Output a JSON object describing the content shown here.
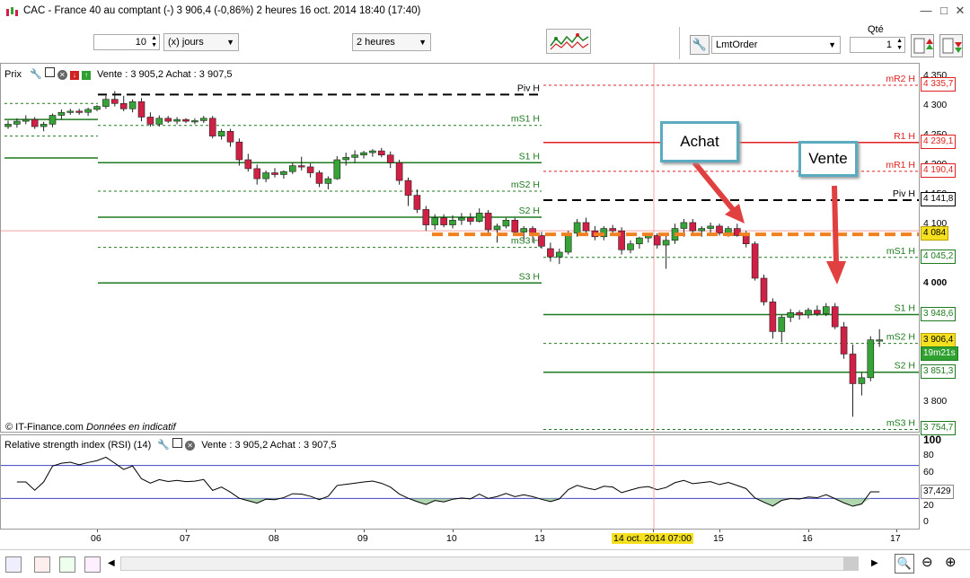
{
  "window": {
    "title": "CAC - France 40 au comptant (-)   3 906,4  (-0,86%)    2 heures   16 oct. 2014 18:40 (17:40)"
  },
  "toolbar": {
    "period_count": "10",
    "period_unit": "(x) jours",
    "interval": "2 heures",
    "qty_label": "Qté",
    "qty_value": "1",
    "order_type": "LmtOrder"
  },
  "price_panel": {
    "header_label": "Prix",
    "quote": "Vente : 3 905,2  Achat : 3 907,5",
    "copyright": "© IT-Finance.com",
    "disclaimer": "Données en indicatif"
  },
  "rsi_panel": {
    "header_label": "Relative strength index (RSI) (14)",
    "quote": "Vente : 3 905,2  Achat : 3 907,5",
    "last_value": "37,429"
  },
  "callouts": {
    "achat": "Achat",
    "vente": "Vente"
  },
  "pivots_left": [
    {
      "label": "Piv H",
      "price": 4320
    },
    {
      "label": "mS1 H",
      "price": 4268
    },
    {
      "label": "S1 H",
      "price": 4205
    },
    {
      "label": "mS2 H",
      "price": 4157
    },
    {
      "label": "S2 H",
      "price": 4113
    },
    {
      "label": "mS3 H",
      "price": 4062
    },
    {
      "label": "S3 H",
      "price": 4002
    }
  ],
  "pivots_right": [
    {
      "label": "mR2 H",
      "price_text": "4 335,7",
      "price": 4335.7
    },
    {
      "label": "R1 H",
      "price_text": "4 239,1",
      "price": 4239.1
    },
    {
      "label": "mR1 H",
      "price_text": "4 190,4",
      "price": 4190.4
    },
    {
      "label": "Piv H",
      "price_text": "4 141,8",
      "price": 4141.8
    },
    {
      "label": "mS1 H",
      "price_text": "4 045,2",
      "price": 4045.2
    },
    {
      "label": "S1 H",
      "price_text": "3 948,6",
      "price": 3948.6
    },
    {
      "label": "mS2 H",
      "price_text": "3 900,0",
      "price": 3900.0
    },
    {
      "label": "S2 H",
      "price_text": "3 851,3",
      "price": 3851.3
    },
    {
      "label": "mS3 H",
      "price_text": "3 754,7",
      "price": 3754.7
    }
  ],
  "price_axis": {
    "ticks": [
      "4 350",
      "4 300",
      "4 250",
      "4 200",
      "4 150",
      "4 100",
      "4 050",
      "4 000",
      "3 950",
      "3 900",
      "3 850",
      "3 800"
    ],
    "orange_level": {
      "text": "4 084",
      "price": 4084
    },
    "last_price": "3 906,4",
    "countdown": "19m21s"
  },
  "rsi_axis": {
    "ticks": [
      "100",
      "80",
      "60",
      "40",
      "20",
      "0"
    ],
    "levels": [
      70,
      30
    ]
  },
  "x_axis": {
    "labels": [
      "06",
      "07",
      "08",
      "09",
      "10",
      "13",
      "14 oct. 2014 07:00",
      "15",
      "16",
      "17"
    ]
  },
  "colors": {
    "bull": "#36a336",
    "bear": "#d02045",
    "support": "#1f7a1f",
    "resistance": "#e02020",
    "pivot": "#000000",
    "orange": "#f08020",
    "callout_border": "#5aaac0",
    "arrow": "#e04040",
    "rsi_line": "#000000",
    "rsi_fill": "#9ccc9c",
    "rsi_level": "#4040c0"
  },
  "icons": {
    "app": "candlestick-app-icon",
    "settings": "wrench-icon",
    "close": "close-icon"
  },
  "chart_data": {
    "type": "candlestick",
    "title": "CAC - France 40 au comptant (-)",
    "xlabel": "",
    "ylabel": "",
    "ylim": [
      3760,
      4360
    ],
    "candles": [
      [
        4266,
        4276,
        4262,
        4270
      ],
      [
        4270,
        4280,
        4264,
        4275
      ],
      [
        4275,
        4285,
        4270,
        4278
      ],
      [
        4278,
        4282,
        4262,
        4266
      ],
      [
        4266,
        4274,
        4258,
        4270
      ],
      [
        4270,
        4288,
        4265,
        4285
      ],
      [
        4285,
        4295,
        4278,
        4290
      ],
      [
        4290,
        4296,
        4286,
        4292
      ],
      [
        4292,
        4296,
        4286,
        4290
      ],
      [
        4290,
        4298,
        4284,
        4295
      ],
      [
        4295,
        4302,
        4292,
        4300
      ],
      [
        4300,
        4318,
        4296,
        4312
      ],
      [
        4312,
        4326,
        4300,
        4305
      ],
      [
        4305,
        4318,
        4292,
        4296
      ],
      [
        4296,
        4312,
        4290,
        4308
      ],
      [
        4308,
        4314,
        4275,
        4282
      ],
      [
        4282,
        4290,
        4266,
        4270
      ],
      [
        4270,
        4285,
        4266,
        4280
      ],
      [
        4280,
        4284,
        4272,
        4275
      ],
      [
        4275,
        4282,
        4270,
        4278
      ],
      [
        4278,
        4280,
        4272,
        4275
      ],
      [
        4275,
        4280,
        4270,
        4276
      ],
      [
        4276,
        4284,
        4272,
        4280
      ],
      [
        4280,
        4284,
        4246,
        4250
      ],
      [
        4250,
        4262,
        4244,
        4258
      ],
      [
        4258,
        4262,
        4232,
        4240
      ],
      [
        4240,
        4246,
        4200,
        4210
      ],
      [
        4210,
        4220,
        4190,
        4195
      ],
      [
        4195,
        4202,
        4168,
        4178
      ],
      [
        4178,
        4192,
        4172,
        4188
      ],
      [
        4188,
        4196,
        4180,
        4185
      ],
      [
        4185,
        4192,
        4178,
        4190
      ],
      [
        4190,
        4205,
        4186,
        4200
      ],
      [
        4200,
        4215,
        4192,
        4198
      ],
      [
        4198,
        4204,
        4180,
        4188
      ],
      [
        4188,
        4192,
        4164,
        4170
      ],
      [
        4170,
        4182,
        4160,
        4178
      ],
      [
        4178,
        4216,
        4176,
        4210
      ],
      [
        4210,
        4222,
        4200,
        4214
      ],
      [
        4214,
        4226,
        4205,
        4218
      ],
      [
        4218,
        4225,
        4212,
        4222
      ],
      [
        4222,
        4228,
        4215,
        4225
      ],
      [
        4225,
        4230,
        4214,
        4218
      ],
      [
        4218,
        4224,
        4196,
        4205
      ],
      [
        4205,
        4210,
        4168,
        4175
      ],
      [
        4175,
        4180,
        4132,
        4150
      ],
      [
        4150,
        4160,
        4120,
        4126
      ],
      [
        4126,
        4132,
        4090,
        4100
      ],
      [
        4100,
        4118,
        4092,
        4112
      ],
      [
        4112,
        4118,
        4096,
        4100
      ],
      [
        4100,
        4116,
        4094,
        4108
      ],
      [
        4108,
        4120,
        4100,
        4112
      ],
      [
        4112,
        4120,
        4100,
        4106
      ],
      [
        4106,
        4128,
        4104,
        4120
      ],
      [
        4120,
        4125,
        4086,
        4092
      ],
      [
        4092,
        4102,
        4070,
        4098
      ],
      [
        4098,
        4112,
        4094,
        4108
      ],
      [
        4108,
        4112,
        4082,
        4088
      ],
      [
        4088,
        4098,
        4074,
        4094
      ],
      [
        4094,
        4098,
        4070,
        4082
      ],
      [
        4082,
        4088,
        4060,
        4064
      ],
      [
        4060,
        4070,
        4038,
        4046
      ],
      [
        4046,
        4060,
        4034,
        4054
      ],
      [
        4054,
        4090,
        4050,
        4086
      ],
      [
        4086,
        4110,
        4080,
        4104
      ],
      [
        4104,
        4112,
        4086,
        4090
      ],
      [
        4090,
        4098,
        4074,
        4080
      ],
      [
        4080,
        4098,
        4074,
        4094
      ],
      [
        4094,
        4100,
        4084,
        4090
      ],
      [
        4090,
        4096,
        4050,
        4058
      ],
      [
        4058,
        4074,
        4052,
        4068
      ],
      [
        4068,
        4080,
        4060,
        4078
      ],
      [
        4078,
        4086,
        4070,
        4082
      ],
      [
        4082,
        4086,
        4060,
        4066
      ],
      [
        4066,
        4082,
        4026,
        4074
      ],
      [
        4074,
        4102,
        4068,
        4094
      ],
      [
        4094,
        4110,
        4080,
        4104
      ],
      [
        4104,
        4110,
        4082,
        4090
      ],
      [
        4090,
        4098,
        4080,
        4094
      ],
      [
        4094,
        4104,
        4086,
        4098
      ],
      [
        4098,
        4102,
        4082,
        4086
      ],
      [
        4086,
        4098,
        4080,
        4094
      ],
      [
        4094,
        4102,
        4080,
        4082
      ],
      [
        4082,
        4090,
        4062,
        4068
      ],
      [
        4068,
        4072,
        4006,
        4010
      ],
      [
        4010,
        4016,
        3964,
        3970
      ],
      [
        3970,
        3976,
        3908,
        3920
      ],
      [
        3920,
        3948,
        3902,
        3944
      ],
      [
        3944,
        3958,
        3936,
        3952
      ],
      [
        3952,
        3956,
        3940,
        3948
      ],
      [
        3948,
        3960,
        3942,
        3956
      ],
      [
        3956,
        3964,
        3946,
        3950
      ],
      [
        3950,
        3968,
        3946,
        3962
      ],
      [
        3962,
        3968,
        3924,
        3928
      ],
      [
        3928,
        3936,
        3874,
        3882
      ],
      [
        3882,
        3898,
        3776,
        3832
      ],
      [
        3832,
        3850,
        3812,
        3842
      ],
      [
        3842,
        3912,
        3836,
        3906
      ],
      [
        3906,
        3924,
        3894,
        3906
      ]
    ]
  }
}
